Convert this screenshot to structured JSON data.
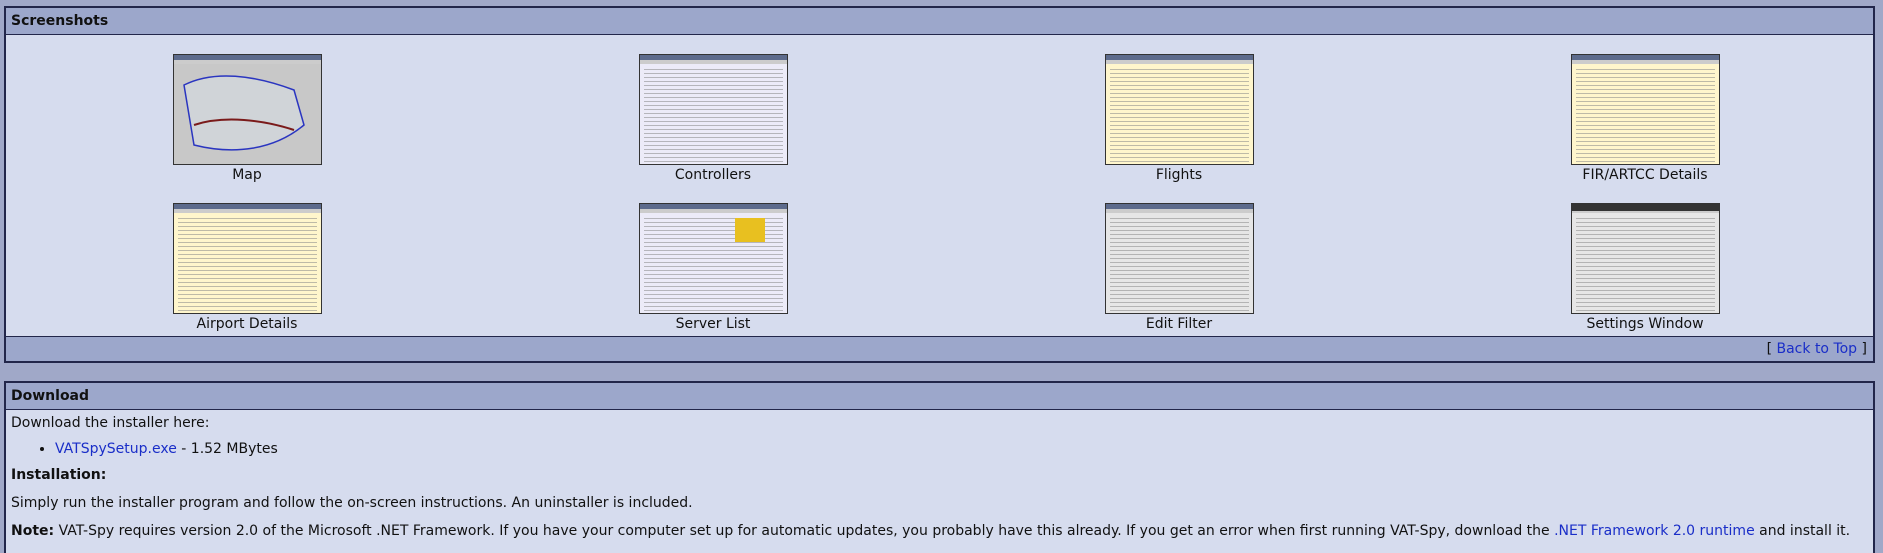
{
  "screenshots": {
    "title": "Screenshots",
    "items": [
      {
        "label": "Map",
        "thumb": "map"
      },
      {
        "label": "Controllers",
        "thumb": "list"
      },
      {
        "label": "Flights",
        "thumb": "yellow"
      },
      {
        "label": "FIR/ARTCC Details",
        "thumb": "split"
      },
      {
        "label": "Airport Details",
        "thumb": "yellow"
      },
      {
        "label": "Server List",
        "thumb": "servers"
      },
      {
        "label": "Edit Filter",
        "thumb": "dialog"
      },
      {
        "label": "Settings Window",
        "thumb": "settings"
      }
    ],
    "back_to_top": {
      "prefix": "[ ",
      "link": "Back to Top",
      "suffix": " ]"
    }
  },
  "download": {
    "title": "Download",
    "intro": "Download the installer here:",
    "file": {
      "name": "VATSpySetup.exe",
      "size": " - 1.52 MBytes"
    },
    "installation_heading": "Installation:",
    "installation_text": "Simply run the installer program and follow the on-screen instructions. An uninstaller is included.",
    "note_label": "Note:",
    "note_text": " VAT-Spy requires version 2.0 of the Microsoft .NET Framework. If you have your computer set up for automatic updates, you probably have this already. If you get an error when first running VAT-Spy, download the ",
    "note_link": ".NET Framework 2.0 runtime",
    "note_end": " and install it."
  },
  "colors": {
    "accent_link": "#1a2ec8",
    "header": "#9ca7cb",
    "panel": "#d6dcee"
  }
}
